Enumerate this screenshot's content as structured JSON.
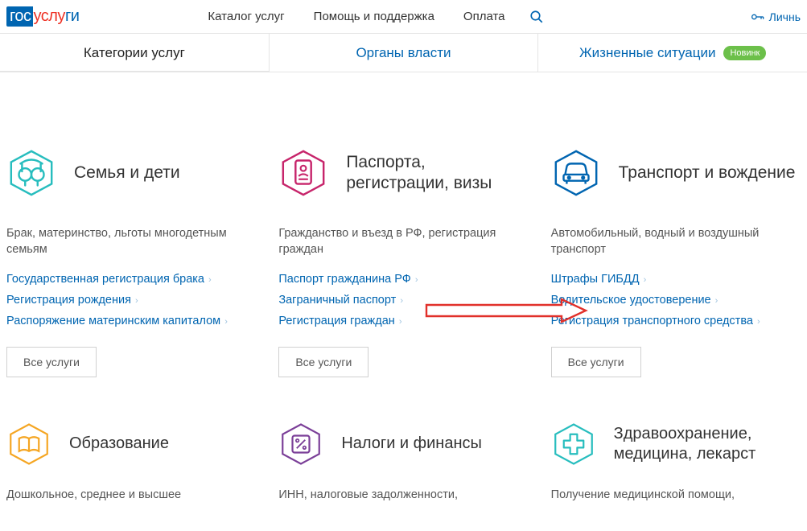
{
  "logo": {
    "p1": "гос",
    "p2": "услу",
    "p3": "ги"
  },
  "nav": {
    "catalog": "Каталог услуг",
    "help": "Помощь и поддержка",
    "pay": "Оплата"
  },
  "login_text": "Личнь",
  "tabs": {
    "t1": "Категории услуг",
    "t2": "Органы власти",
    "t3": "Жизненные ситуации",
    "badge": "Новинк"
  },
  "cats": {
    "family": {
      "title": "Семья и дети",
      "desc": "Брак, материнство, льготы многодетным семьям",
      "l1": "Государственная регистрация брака",
      "l2": "Регистрация рождения",
      "l3": "Распоряжение материнским капиталом"
    },
    "passport": {
      "title": "Паспорта, регистрации, визы",
      "desc": "Гражданство и въезд в РФ, регистрация граждан",
      "l1": "Паспорт гражданина РФ",
      "l2": "Заграничный паспорт",
      "l3": "Регистрация граждан"
    },
    "transport": {
      "title": "Транспорт и вождение",
      "desc": "Автомобильный, водный и воздушный транспорт",
      "l1": "Штрафы ГИБДД",
      "l2": "Водительское удостоверение",
      "l3": "Регистрация транспортного средства"
    },
    "edu": {
      "title": "Образование",
      "desc": "Дошкольное, среднее и высшее"
    },
    "tax": {
      "title": "Налоги и финансы",
      "desc": "ИНН, налоговые задолженности,"
    },
    "health": {
      "title": "Здравоохранение, медицина, лекарст",
      "desc": "Получение медицинской помощи,"
    }
  },
  "btn_all": "Все услуги"
}
